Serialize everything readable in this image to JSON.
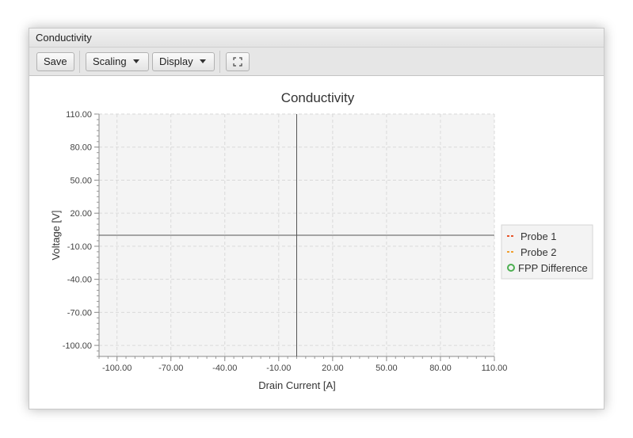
{
  "window": {
    "title": "Conductivity"
  },
  "toolbar": {
    "save_label": "Save",
    "scaling_label": "Scaling",
    "display_label": "Display",
    "fullscreen_icon": "fullscreen-icon"
  },
  "chart_data": {
    "type": "line",
    "title": "Conductivity",
    "xlabel": "Drain Current [A]",
    "ylabel": "Voltage [V]",
    "xlim": [
      -110,
      110
    ],
    "ylim": [
      -110,
      110
    ],
    "x_ticks": [
      "-100.00",
      "-70.00",
      "-40.00",
      "-10.00",
      "20.00",
      "50.00",
      "80.00",
      "110.00"
    ],
    "y_ticks": [
      "110.00",
      "80.00",
      "50.00",
      "20.00",
      "-10.00",
      "-40.00",
      "-70.00",
      "-100.00"
    ],
    "x_tick_values": [
      -100,
      -70,
      -40,
      -10,
      20,
      50,
      80,
      110
    ],
    "y_tick_values": [
      110,
      80,
      50,
      20,
      -10,
      -40,
      -70,
      -100
    ],
    "grid": true,
    "legend_position": "right",
    "series": [
      {
        "name": "Probe 1",
        "marker": "dash",
        "color": "#e8552a",
        "values": []
      },
      {
        "name": "Probe 2",
        "marker": "dash",
        "color": "#f0a030",
        "values": []
      },
      {
        "name": "FPP Difference",
        "marker": "circle",
        "color": "#4caf50",
        "values": []
      }
    ]
  }
}
